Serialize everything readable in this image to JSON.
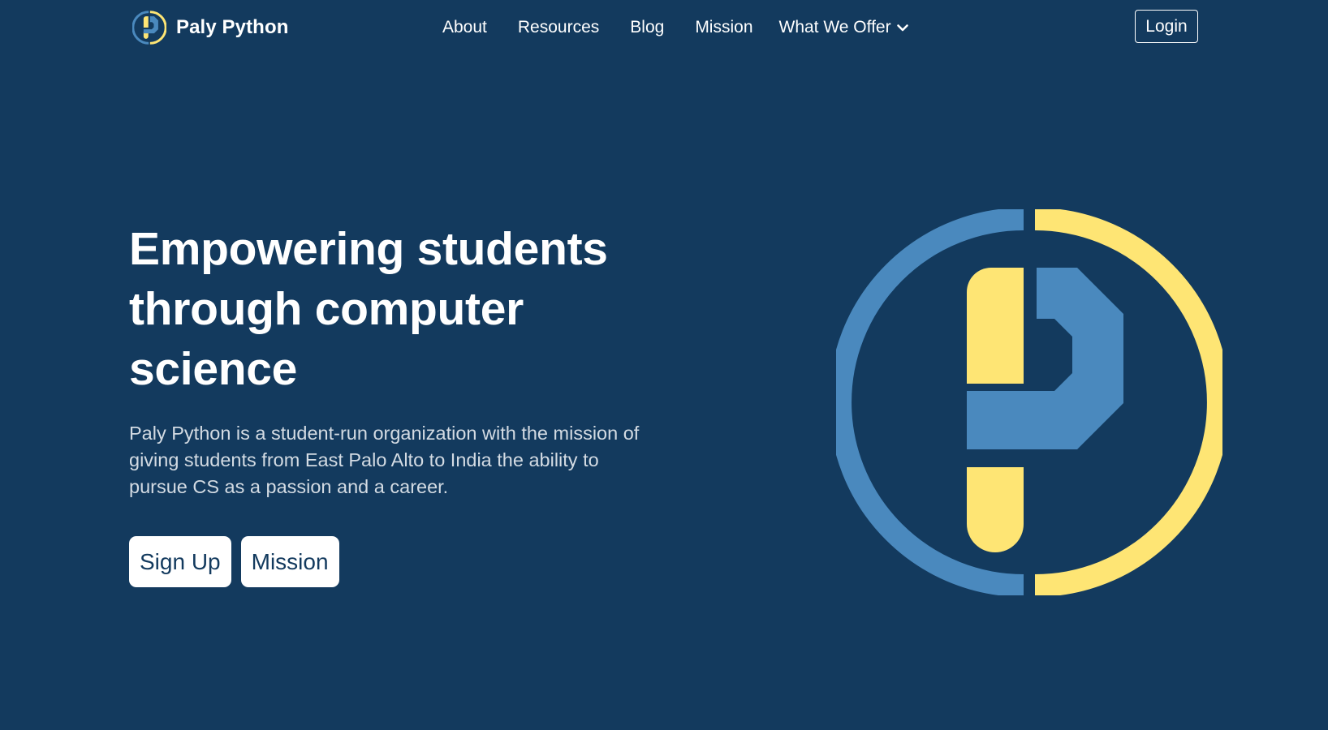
{
  "nav": {
    "brand_name": "Paly Python",
    "links": [
      {
        "label": "About"
      },
      {
        "label": "Resources"
      },
      {
        "label": "Blog"
      },
      {
        "label": "Mission"
      }
    ],
    "dropdown_label": "What We Offer",
    "login_label": "Login"
  },
  "hero": {
    "title_lines": [
      "Empowering students",
      "through computer",
      "science"
    ],
    "description_lines": [
      "Paly Python is a student-run organization with the mission of",
      "giving students from East Palo Alto to India the ability to",
      "pursue CS as a passion and a career."
    ],
    "primary_button": "Sign Up",
    "secondary_button": "Mission"
  },
  "colors": {
    "background": "#133a5e",
    "logo_blue": "#4a89be",
    "logo_yellow": "#fee574",
    "button_text": "#133a5e"
  }
}
